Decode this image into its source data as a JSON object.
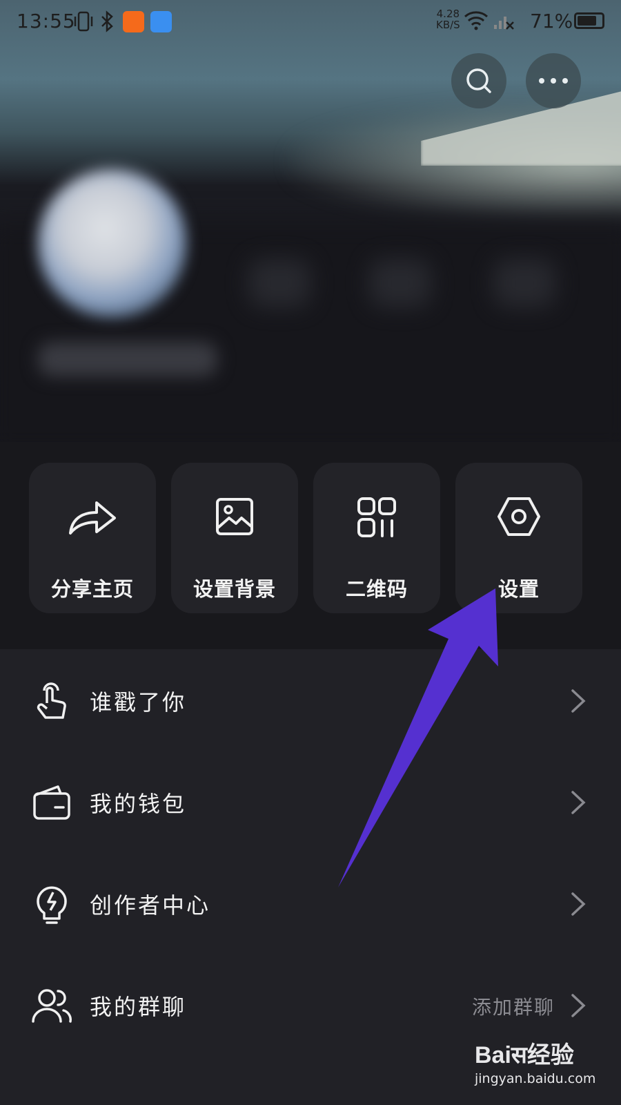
{
  "status_bar": {
    "time": "13:55",
    "net_speed_value": "4.28",
    "net_speed_unit": "KB/S",
    "battery": "71%"
  },
  "actions": [
    {
      "label": "分享主页",
      "icon": "share-icon"
    },
    {
      "label": "设置背景",
      "icon": "image-icon"
    },
    {
      "label": "二维码",
      "icon": "qr-code-icon"
    },
    {
      "label": "设置",
      "icon": "settings-icon"
    }
  ],
  "menu": [
    {
      "label": "谁戳了你",
      "icon": "tap-hand-icon",
      "extra": ""
    },
    {
      "label": "我的钱包",
      "icon": "wallet-icon",
      "extra": ""
    },
    {
      "label": "创作者中心",
      "icon": "lightbulb-icon",
      "extra": ""
    },
    {
      "label": "我的群聊",
      "icon": "group-icon",
      "extra": "添加群聊"
    }
  ],
  "watermark": {
    "logo": "Baiस经验",
    "url": "jingyan.baidu.com"
  },
  "colors": {
    "annotation_arrow": "#5530d0",
    "background": "#212126",
    "card": "#232328"
  }
}
